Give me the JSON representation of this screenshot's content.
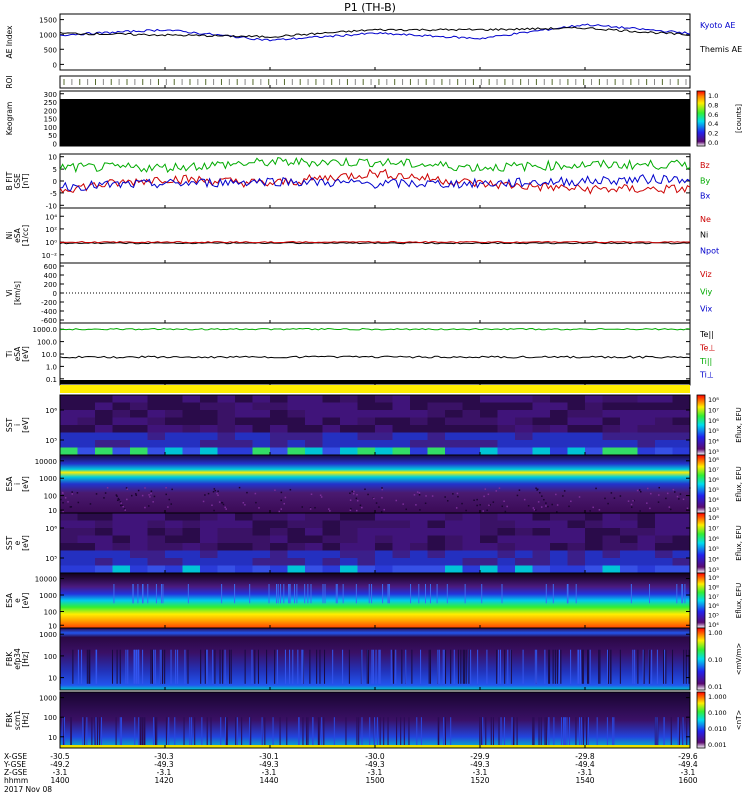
{
  "title": "P1 (TH-B)",
  "panels": [
    {
      "id": "ae",
      "ylabel": [
        "AE Index"
      ],
      "ticks": [
        "1500",
        "1000",
        "500",
        "0"
      ],
      "legend": [
        {
          "text": "Kyoto AE",
          "color": "#0000cc"
        },
        {
          "text": "Themis AE",
          "color": "#000000"
        }
      ]
    },
    {
      "id": "roi",
      "ylabel": [
        "ROI"
      ],
      "ticks": [],
      "legend": []
    },
    {
      "id": "keogram",
      "ylabel": [
        "Keogram"
      ],
      "ticks": [
        "300",
        "250",
        "200",
        "150",
        "100",
        "50",
        "0"
      ],
      "legend": []
    },
    {
      "id": "bfield",
      "ylabel": [
        "B FIT",
        "GSE",
        "[nT]"
      ],
      "ticks": [
        "10",
        "5",
        "0",
        "-5",
        "-10"
      ],
      "legend": [
        {
          "text": "Bz",
          "color": "#cc0000"
        },
        {
          "text": "By",
          "color": "#00aa00"
        },
        {
          "text": "Bx",
          "color": "#0000cc"
        }
      ]
    },
    {
      "id": "density",
      "ylabel": [
        "Ni",
        "eSA",
        "[1/cc]"
      ],
      "ticks": [
        "10⁴",
        "10²",
        "10⁰",
        "10⁻²"
      ],
      "legend": [
        {
          "text": "Ne",
          "color": "#cc0000"
        },
        {
          "text": "Ni",
          "color": "#000000"
        },
        {
          "text": "Npot",
          "color": "#0000cc"
        }
      ]
    },
    {
      "id": "velocity",
      "ylabel": [
        "Vi",
        "[km/s]"
      ],
      "ticks": [
        "600",
        "400",
        "200",
        "0",
        "-200",
        "-400",
        "-600"
      ],
      "legend": [
        {
          "text": "Viz",
          "color": "#cc0000"
        },
        {
          "text": "Viy",
          "color": "#00aa00"
        },
        {
          "text": "Vix",
          "color": "#0000cc"
        }
      ]
    },
    {
      "id": "temperature",
      "ylabel": [
        "Ti",
        "eSA",
        "[eV]"
      ],
      "ticks": [
        "1000.0",
        "100.0",
        "10.0",
        "1.0",
        "0.1"
      ],
      "legend": [
        {
          "text": "Te||",
          "color": "#000000"
        },
        {
          "text": "Te⊥",
          "color": "#cc0000"
        },
        {
          "text": "Ti||",
          "color": "#00aa00"
        },
        {
          "text": "Ti⊥",
          "color": "#0000cc"
        }
      ]
    },
    {
      "id": "sst_i",
      "ylabel": [
        "SST",
        "i",
        "[eV]"
      ],
      "ticks": [
        "10⁶",
        "10⁵"
      ],
      "legend": []
    },
    {
      "id": "esa_i",
      "ylabel": [
        "ESA",
        "i",
        "[eV]"
      ],
      "ticks": [
        "10000",
        "1000",
        "100",
        "10"
      ],
      "legend": []
    },
    {
      "id": "sst_e",
      "ylabel": [
        "SST",
        "e",
        "[eV]"
      ],
      "ticks": [
        "10⁶",
        "10⁵"
      ],
      "legend": []
    },
    {
      "id": "esa_e",
      "ylabel": [
        "ESA",
        "e",
        "[eV]"
      ],
      "ticks": [
        "10000",
        "1000",
        "100",
        "10"
      ],
      "legend": []
    },
    {
      "id": "fbk_e",
      "ylabel": [
        "FBK",
        "efp34",
        "[Hz]"
      ],
      "ticks": [
        "1000",
        "100",
        "10"
      ],
      "legend": []
    },
    {
      "id": "fbk_b",
      "ylabel": [
        "FBK",
        "scm1",
        "[Hz]"
      ],
      "ticks": [
        "1000",
        "100",
        "10"
      ],
      "legend": []
    }
  ],
  "colorbars": [
    {
      "id": "cb-keogram",
      "label": "[counts]",
      "ticks": [
        "1.0",
        "0.8",
        "0.6",
        "0.4",
        "0.2",
        "0.0"
      ]
    },
    {
      "id": "cb-sst-i",
      "label": "Eflux, EFU",
      "ticks": [
        "10⁸",
        "10⁷",
        "10⁶",
        "10⁵",
        "10⁴",
        "10³"
      ]
    },
    {
      "id": "cb-esa-i",
      "label": "Eflux, EFU",
      "ticks": [
        "10⁸",
        "10⁷",
        "10⁶",
        "10⁵",
        "10⁴",
        "10³"
      ]
    },
    {
      "id": "cb-sst-e",
      "label": "Eflux, EFU",
      "ticks": [
        "10⁸",
        "10⁷",
        "10⁶",
        "10⁵",
        "10⁴",
        "10³"
      ]
    },
    {
      "id": "cb-esa-e",
      "label": "Eflux, EFU",
      "ticks": [
        "10⁹",
        "10⁸",
        "10⁷",
        "10⁶",
        "10⁵",
        "10⁴"
      ]
    },
    {
      "id": "cb-fbk-e",
      "label": "<mV/m>",
      "ticks": [
        "1.00",
        "0.10",
        "0.01"
      ]
    },
    {
      "id": "cb-fbk-b",
      "label": "<nT>",
      "ticks": [
        "1.000",
        "0.100",
        "0.010",
        "0.001"
      ]
    }
  ],
  "time_axis": {
    "row_labels": [
      "X-GSE",
      "Y-GSE",
      "Z-GSE",
      "hhmm",
      "2017 Nov 08"
    ],
    "columns": [
      {
        "x": "-30.5",
        "y": "-49.2",
        "z": "-3.1",
        "t": "1400"
      },
      {
        "x": "-30.3",
        "y": "-49.3",
        "z": "-3.1",
        "t": "1420"
      },
      {
        "x": "-30.1",
        "y": "-49.3",
        "z": "-3.1",
        "t": "1440"
      },
      {
        "x": "-30.0",
        "y": "-49.3",
        "z": "-3.1",
        "t": "1500"
      },
      {
        "x": "-29.9",
        "y": "-49.3",
        "z": "-3.1",
        "t": "1520"
      },
      {
        "x": "-29.8",
        "y": "-49.4",
        "z": "-3.1",
        "t": "1540"
      },
      {
        "x": "-29.6",
        "y": "-49.4",
        "z": "-3.1",
        "t": "1600"
      }
    ]
  },
  "chart_data": [
    {
      "type": "line",
      "panel": "AE Index",
      "x": [
        "1400",
        "1420",
        "1440",
        "1500",
        "1520",
        "1540",
        "1600"
      ],
      "ylim": [
        0,
        1600
      ],
      "series": [
        {
          "name": "Kyoto AE",
          "color": "#0000cc",
          "values": [
            1000,
            1150,
            850,
            1050,
            900,
            1300,
            1050
          ]
        },
        {
          "name": "Themis AE",
          "color": "#000000",
          "values": [
            1050,
            1000,
            950,
            1150,
            1150,
            1200,
            1000
          ]
        }
      ]
    },
    {
      "type": "line",
      "panel": "B FIT GSE",
      "x": [
        "1400",
        "1420",
        "1440",
        "1500",
        "1520",
        "1540",
        "1600"
      ],
      "ylim": [
        -10,
        10
      ],
      "series": [
        {
          "name": "Bz",
          "color": "#cc0000",
          "values": [
            -3,
            1,
            -1,
            3,
            -1,
            -3,
            -3
          ]
        },
        {
          "name": "By",
          "color": "#00aa00",
          "values": [
            5,
            5,
            7,
            7,
            5,
            6,
            6
          ]
        },
        {
          "name": "Bx",
          "color": "#0000cc",
          "values": [
            -2,
            -1,
            0,
            -1,
            -1,
            0,
            1
          ]
        }
      ]
    },
    {
      "type": "line",
      "panel": "Ni eSA",
      "ylim": [
        "10⁻²",
        "10⁴"
      ],
      "series": [
        {
          "name": "Ne",
          "color": "#cc0000",
          "values": [
            1,
            1,
            1,
            1,
            1,
            1,
            1
          ]
        },
        {
          "name": "Ni",
          "color": "#000000",
          "values": [
            1,
            1,
            1,
            1,
            1,
            1,
            1
          ]
        }
      ]
    },
    {
      "type": "line",
      "panel": "Ti eSA",
      "ylim": [
        0.1,
        1000
      ],
      "series": [
        {
          "name": "Ti||",
          "color": "#00aa00",
          "values": [
            1500,
            1500,
            1500,
            1500,
            1500,
            1500,
            1500
          ]
        },
        {
          "name": "Te||",
          "color": "#000000",
          "values": [
            15,
            15,
            15,
            15,
            15,
            15,
            15
          ]
        }
      ]
    }
  ]
}
